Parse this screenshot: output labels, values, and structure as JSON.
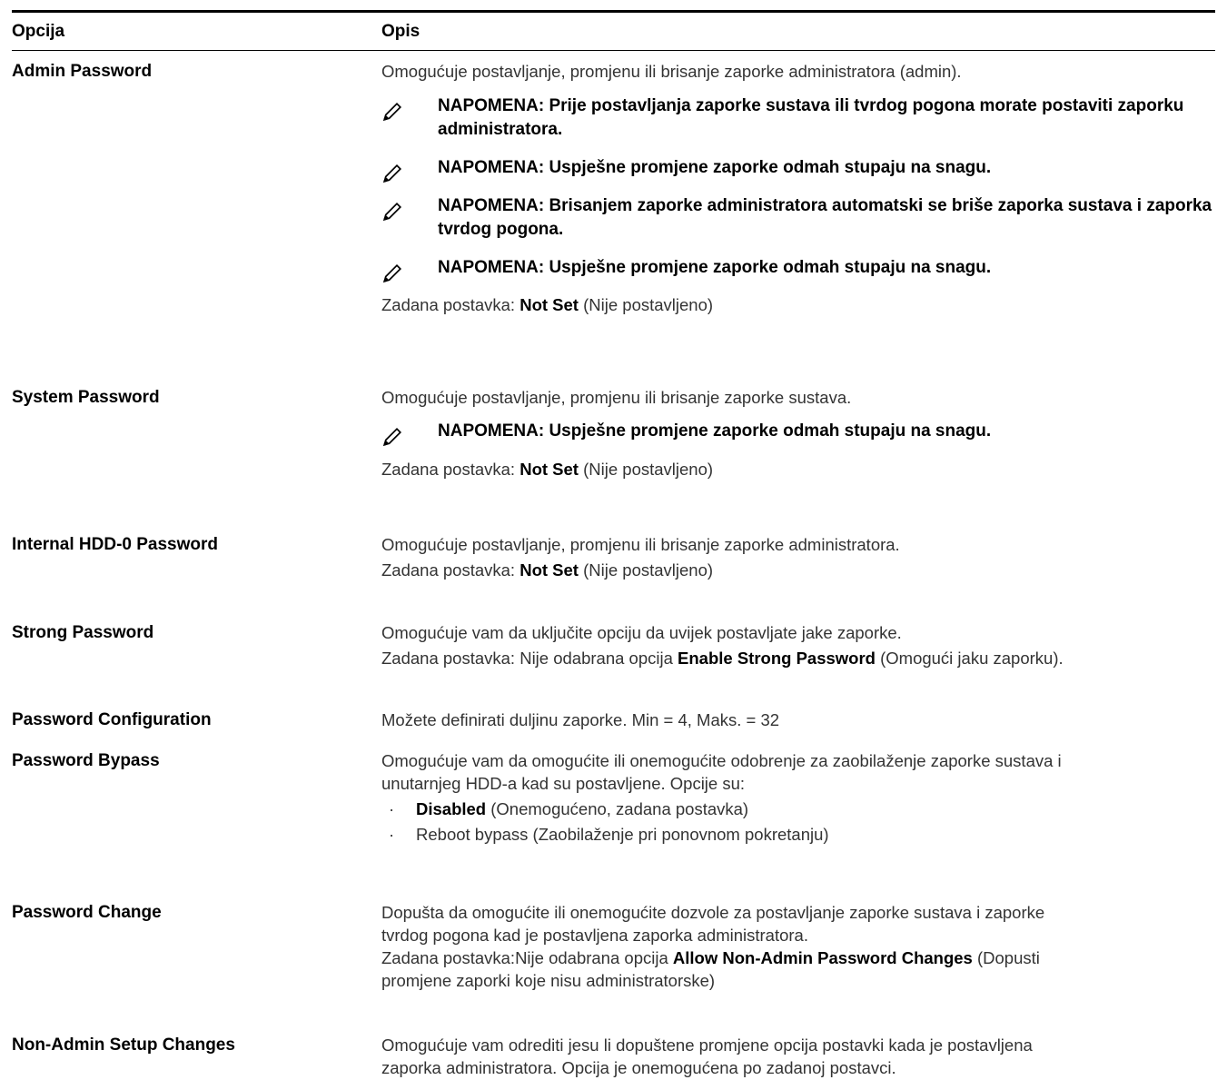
{
  "header": {
    "col_option": "Opcija",
    "col_description": "Opis"
  },
  "rows": {
    "admin": {
      "option": "Admin Password",
      "desc": "Omogućuje postavljanje, promjenu ili brisanje zaporke administratora (admin).",
      "notes": [
        "NAPOMENA: Prije postavljanja zaporke sustava ili tvrdog pogona morate postaviti zaporku administratora.",
        "NAPOMENA: Uspješne promjene zaporke odmah stupaju na snagu.",
        "NAPOMENA: Brisanjem zaporke administratora automatski se briše zaporka sustava i zaporka tvrdog pogona.",
        "NAPOMENA: Uspješne promjene zaporke odmah stupaju na snagu."
      ],
      "default_prefix": "Zadana postavka: ",
      "default_value": "Not Set",
      "default_suffix": " (Nije postavljeno)"
    },
    "system": {
      "option": "System Password",
      "desc": "Omogućuje postavljanje, promjenu ili brisanje zaporke sustava.",
      "notes": [
        "NAPOMENA: Uspješne promjene zaporke odmah stupaju na snagu."
      ],
      "default_prefix": "Zadana postavka: ",
      "default_value": "Not Set",
      "default_suffix": " (Nije postavljeno)"
    },
    "hdd": {
      "option": "Internal HDD-0 Password",
      "desc": "Omogućuje postavljanje, promjenu ili brisanje zaporke administratora.",
      "default_prefix": "Zadana postavka: ",
      "default_value": "Not Set",
      "default_suffix": " (Nije postavljeno)"
    },
    "strong": {
      "option": "Strong Password",
      "desc": "Omogućuje vam da uključite opciju da uvijek postavljate jake zaporke.",
      "default_prefix": "Zadana postavka: Nije odabrana opcija ",
      "default_value": "Enable Strong Password",
      "default_suffix": " (Omogući jaku zaporku)."
    },
    "config": {
      "option": "Password Configuration",
      "desc": "Možete definirati duljinu zaporke. Min = 4, Maks. = 32"
    },
    "bypass": {
      "option": "Password Bypass",
      "desc_line1": "Omogućuje vam da omogućite ili onemogućite odobrenje za zaobilaženje zaporke sustava i",
      "desc_line2": "unutarnjeg HDD-a kad su postavljene. Opcije su:",
      "bullet": "·",
      "item1_bold": "Disabled",
      "item1_rest": " (Onemogućeno, zadana postavka)",
      "item2": "Reboot bypass (Zaobilaženje pri ponovnom pokretanju)"
    },
    "change": {
      "option": "Password Change",
      "desc_line1": "Dopušta da omogućite ili onemogućite dozvole za postavljanje zaporke sustava i zaporke",
      "desc_line2": "tvrdog pogona kad je postavljena zaporka administratora.",
      "default_prefix": "Zadana postavka:Nije odabrana opcija ",
      "default_value": "Allow Non-Admin Password Changes",
      "default_suffix": " (Dopusti",
      "default_line2": "promjene zaporki koje nisu administratorske)"
    },
    "nonadmin": {
      "option": "Non-Admin Setup Changes",
      "desc_line1": "Omogućuje vam odrediti jesu li dopuštene promjene opcija postavki kada je postavljena",
      "desc_line2": "zaporka administratora. Opcija je onemogućena po zadanoj postavci."
    }
  },
  "icons": {
    "note": "pencil-note-icon"
  },
  "colors": {
    "text": "#333333",
    "heading": "#000000",
    "rule": "#000000"
  }
}
